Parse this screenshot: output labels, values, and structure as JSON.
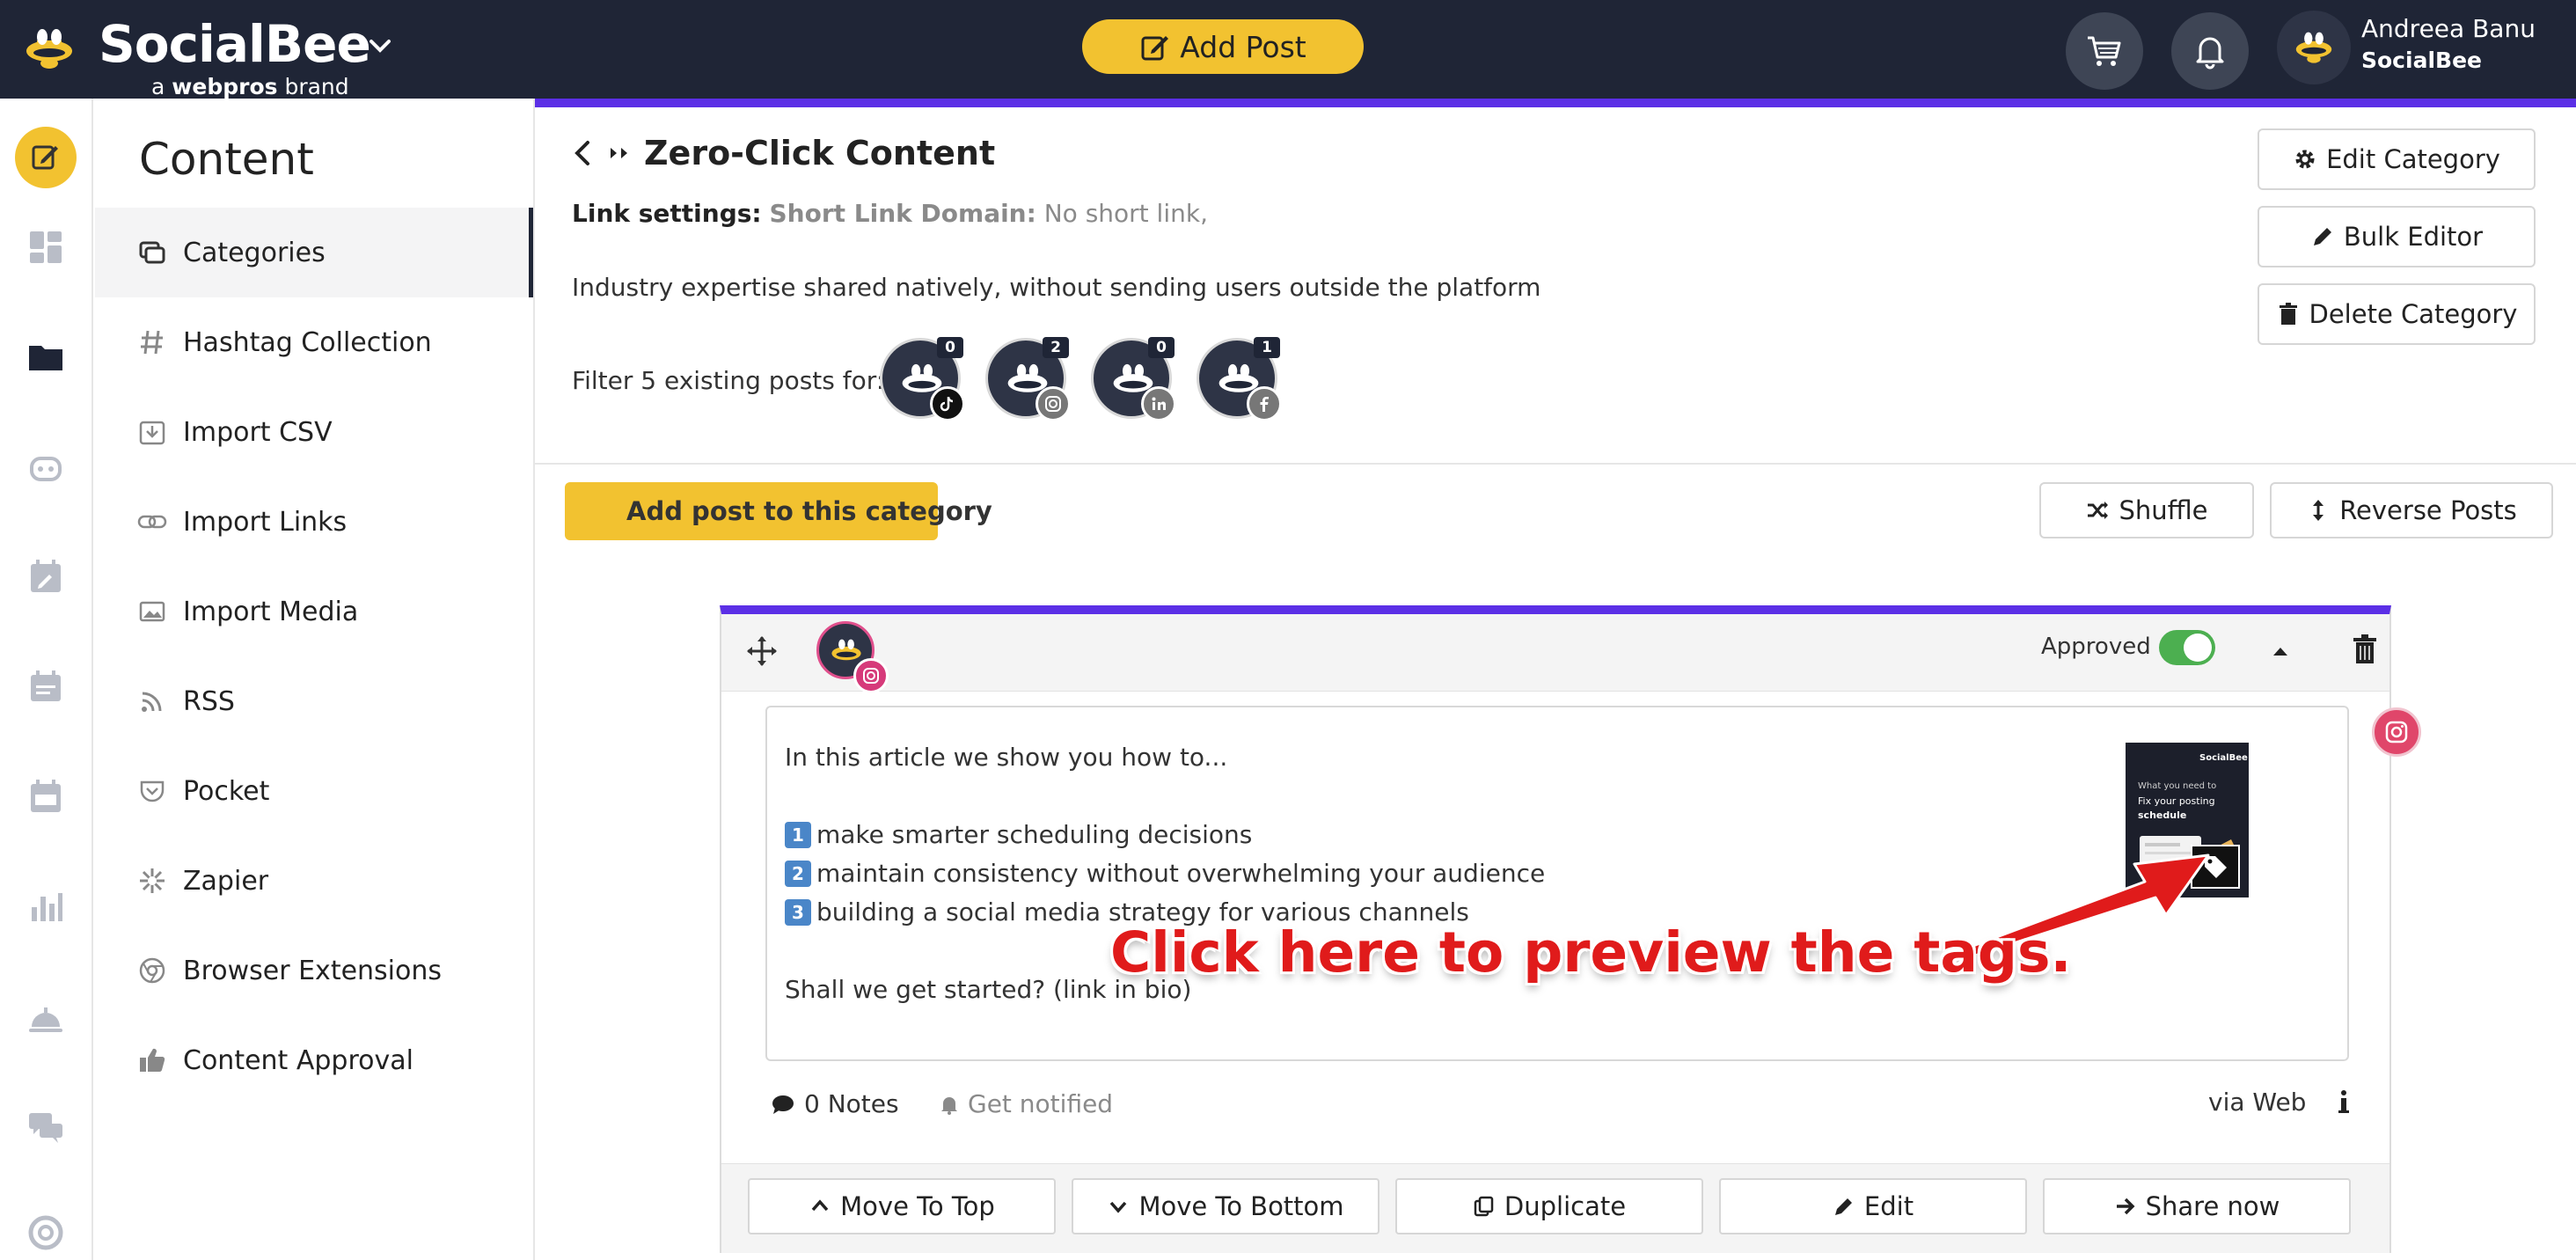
{
  "header": {
    "brand": "SocialBee",
    "brand_sub_prefix": "a",
    "brand_sub_name": "webpros",
    "brand_sub_suffix": "brand",
    "add_post_label": "Add Post",
    "user_name": "Andreea Banu",
    "user_org": "SocialBee",
    "accent_color": "#5b2fe6",
    "brand_color": "#f2c230"
  },
  "rail": {
    "icons": [
      "edit-icon",
      "dashboard-icon",
      "folder-icon",
      "robot-icon",
      "calendar-edit-icon",
      "list-icon",
      "calendar-icon",
      "chart-icon",
      "service-bell-icon",
      "chat-icon",
      "help-icon"
    ]
  },
  "sidebar": {
    "title": "Content",
    "items": [
      {
        "label": "Categories",
        "icon": "categories-icon",
        "active": true
      },
      {
        "label": "Hashtag Collection",
        "icon": "hashtag-icon"
      },
      {
        "label": "Import CSV",
        "icon": "import-csv-icon"
      },
      {
        "label": "Import Links",
        "icon": "link-icon"
      },
      {
        "label": "Import Media",
        "icon": "image-icon"
      },
      {
        "label": "RSS",
        "icon": "rss-icon"
      },
      {
        "label": "Pocket",
        "icon": "pocket-icon"
      },
      {
        "label": "Zapier",
        "icon": "zapier-icon"
      },
      {
        "label": "Browser Extensions",
        "icon": "chrome-icon"
      },
      {
        "label": "Content Approval",
        "icon": "thumbs-up-icon"
      }
    ]
  },
  "category": {
    "title": "Zero-Click Content",
    "link_settings_label": "Link settings:",
    "short_link_label": "Short Link Domain:",
    "short_link_value": "No short link,",
    "description": "Industry expertise shared natively, without sending users outside the platform",
    "filter_label": "Filter 5 existing posts for:",
    "profiles": [
      {
        "network": "tiktok",
        "count": "0"
      },
      {
        "network": "instagram",
        "count": "2"
      },
      {
        "network": "linkedin",
        "count": "0"
      },
      {
        "network": "facebook",
        "count": "1"
      }
    ],
    "edit_label": "Edit Category",
    "bulk_label": "Bulk Editor",
    "delete_label": "Delete Category",
    "add_post_label": "Add post to this category",
    "shuffle_label": "Shuffle",
    "reverse_label": "Reverse Posts"
  },
  "post": {
    "network": "instagram",
    "approved_label": "Approved",
    "approved": true,
    "lines": {
      "intro": "In this article we show you how to...",
      "item1": "make smarter scheduling decisions",
      "item2": "maintain consistency without overwhelming your audience",
      "item3": "building a social media strategy for various channels",
      "outro": "Shall we get started? (link in bio)"
    },
    "numbers": [
      "1",
      "2",
      "3"
    ],
    "thumbnail": {
      "brand": "SocialBee",
      "line1": "What you need to",
      "line2": "Fix your posting",
      "line3": "schedule"
    },
    "notes_label": "0 Notes",
    "notify_label": "Get notified",
    "via_label": "via Web",
    "actions": {
      "move_top": "Move To Top",
      "move_bottom": "Move To Bottom",
      "duplicate": "Duplicate",
      "edit": "Edit",
      "share": "Share now"
    }
  },
  "annotation": {
    "text": "Click here to preview the tags.",
    "color": "#e01b1b"
  }
}
